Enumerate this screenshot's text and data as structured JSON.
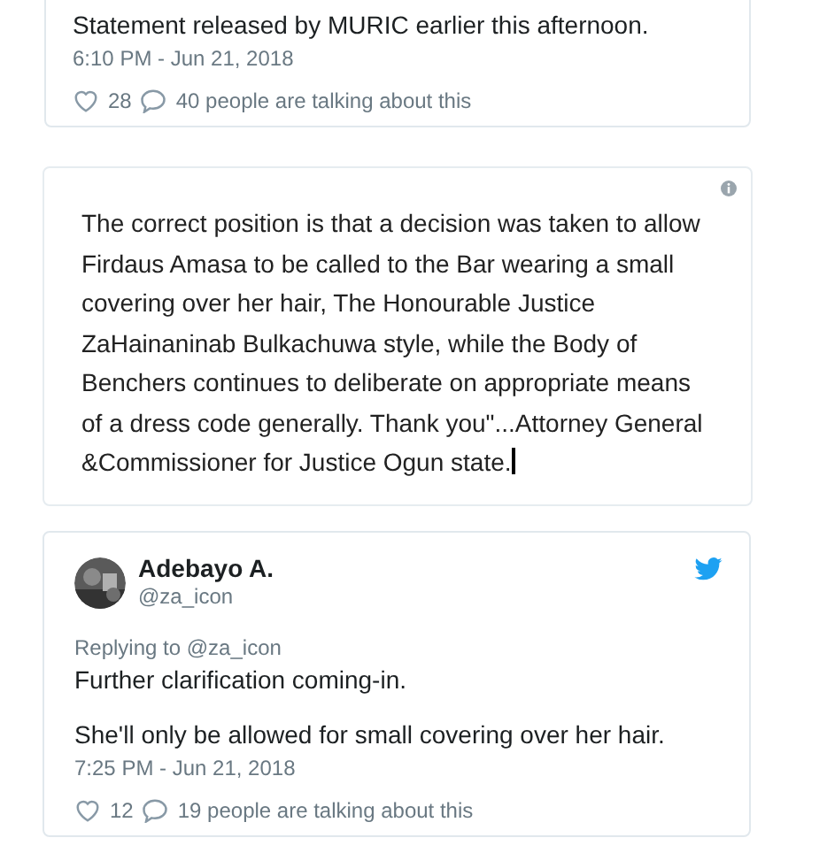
{
  "tweet_top": {
    "text": "Statement released by MURIC earlier this afternoon.",
    "time": "6:10 PM - Jun 21, 2018",
    "likes": "28",
    "talking": "40 people are talking about this"
  },
  "quote": {
    "text": "The correct position is that a decision was taken to allow Firdaus Amasa to be called to the Bar wearing a small covering over her hair, The Honourable Justice ZaHainaninab Bulkachuwa style, while the Body of Benchers continues to deliberate on appropriate means of a dress code generally. Thank you\"...Attorney General &Commissioner for Justice Ogun state."
  },
  "tweet_bottom": {
    "name": "Adebayo A.",
    "handle": "@za_icon",
    "replying": "Replying to @za_icon",
    "lines": [
      "Further clarification coming-in.",
      "She'll only be allowed for small covering over her hair."
    ],
    "time": "7:25 PM - Jun 21, 2018",
    "likes": "12",
    "talking": "19 people are talking about this"
  }
}
